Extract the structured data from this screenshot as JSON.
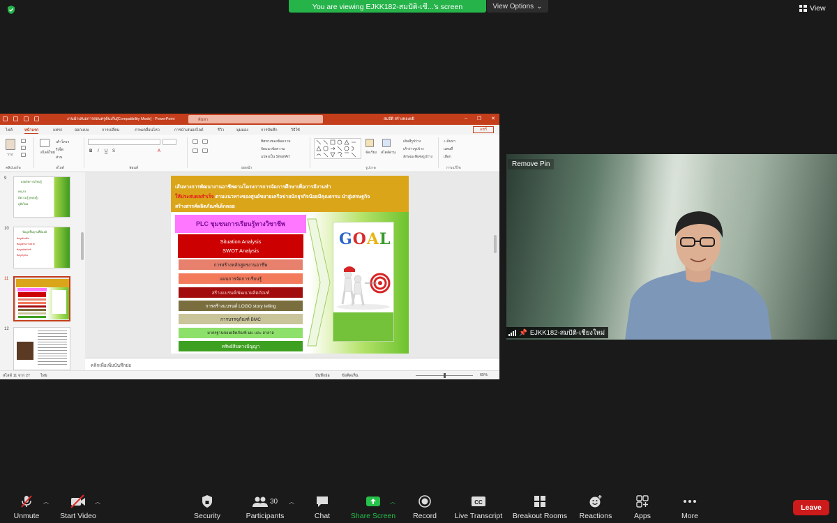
{
  "top": {
    "viewing_banner": "You are viewing EJKK182-สมปัติ-เชี...'s screen",
    "view_options": "View Options",
    "view_label": "View"
  },
  "ppt": {
    "doc_title": "งานนำเสนอการสอนครูต้นเก้น[Compatibility Mode] - PowerPoint",
    "search_placeholder": "ค้นหา",
    "user": "สมปัติ สร้างทองผยิ",
    "tabs": [
      "ไฟล์",
      "หน้าแรก",
      "แทรก",
      "ออกแบบ",
      "การเปลี่ยน",
      "ภาพเคลื่อนไหว",
      "การนำเสนอสไลด์",
      "รีวิว",
      "มุมมอง",
      "การบันทึก",
      "วิธีใช้"
    ],
    "share": "แชร์",
    "groups": [
      "คลิปบอร์ด",
      "สไลด์",
      "ฟอนต์",
      "ย่อหน้า",
      "รูปวาด",
      "การแก้ไข"
    ],
    "ribbon": {
      "paste": "วาง",
      "new_slide": "สไลด์ใหม่",
      "layout": "เค้าโครง",
      "reset": "รีเซ็ต",
      "section": "ส่วน",
      "text_direction": "ทิศทางของข้อความ",
      "align_text": "จัดแนวข้อความ",
      "smartart": "แปลงเป็น SmartArt",
      "arrange": "จัดเรียง",
      "quick_styles": "สไตล์ด่วน",
      "shape_fill": "เติมสีรูปร่าง",
      "shape_outline": "เค้าร่างรูปร่าง",
      "shape_effects": "ลักษณะพิเศษรูปร่าง",
      "find": "ค้นหา",
      "replace": "แทนที่",
      "select": "เลือก"
    },
    "thumbnails": [
      {
        "num": "9",
        "title": "ผลผลิตการเรียนรู้",
        "lines": [
          "คนเก่ง",
          "มีความรู้ (ทฤษฎี)",
          "ดูสิ่งใหม่"
        ]
      },
      {
        "num": "10",
        "title": "ข้อมูลพื้นฐานที่ต้องมี",
        "lines": [
          "ข้อมูลด้านพืช",
          "ข้อมูลด้านการตลาด",
          "ข้อมูลผลิตภัณฑ์",
          "ข้อมูลชุมชน"
        ]
      },
      {
        "num": "11",
        "title": "",
        "lines": []
      },
      {
        "num": "12",
        "title": "",
        "lines": []
      }
    ],
    "notes": "คลิกเพื่อเพิ่มบันทึกย่อ",
    "status_left": "สไลด์ 11 จาก 27",
    "status_lang": "ไทย",
    "status_notes": "บันทึกย่อ",
    "status_comments": "ข้อคิดเห็น",
    "zoom": "65%"
  },
  "slide": {
    "header_line1": "เส้นทางการพัฒนางานอาชีพตามโครงการการจัดการศึกษาเพื่อการมีงานทำ",
    "header_red": "ให้ประสบผลสำเร็จ",
    "header_line2_rest": " ตามแนวทางของศูนย์ขยายเครือข่ายนักธุรกิจน้อยมีคุณธรรม นำสู่เศรษฐกิจ",
    "header_line3": "สร้างสรรค์ผลิตภัณฑ์เด็กดอย",
    "plc_title": "PLC ชุมชนการเรียนรู้ทางวิชาชีพ",
    "swot_line1": "Situation Analysis",
    "swot_line2": "SWOT Analysis",
    "steps": [
      "การสร้างหลักสูตรงานอาชีพ",
      "แผนการจัดการเรียนรู้",
      "สร้างแบรนด์/พัฒนาผลิตภัณฑ์",
      "การสร้างแบรนด์   LOGO  story telling",
      "การบรรจุภัณฑ์ BMC",
      "มาตรฐานของผลิตภัณฑ์  มผ.  และ  ฮาลาล",
      "ทรัพย์สินทางปัญญา"
    ],
    "goal_text": "GOAL"
  },
  "video": {
    "remove_pin": "Remove Pin",
    "participant_name": "EJKK182-สมปัติ-เชียงใหม่"
  },
  "toolbar": {
    "unmute": "Unmute",
    "start_video": "Start Video",
    "security": "Security",
    "participants": "Participants",
    "participants_count": "30",
    "chat": "Chat",
    "share_screen": "Share Screen",
    "record": "Record",
    "live_transcript": "Live Transcript",
    "breakout_rooms": "Breakout Rooms",
    "reactions": "Reactions",
    "apps": "Apps",
    "more": "More",
    "leave": "Leave"
  },
  "colors": {
    "zoom_green": "#25b34a",
    "ppt_accent": "#c43e1c",
    "leave_red": "#cd1a1a"
  }
}
